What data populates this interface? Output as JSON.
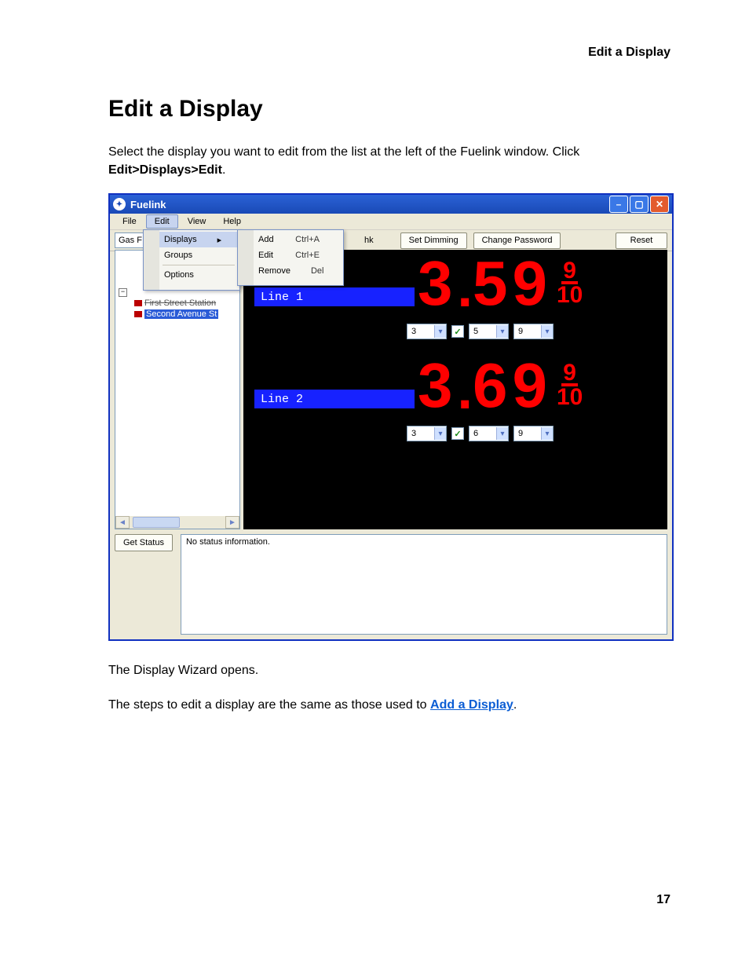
{
  "doc": {
    "running_head": "Edit a Display",
    "title": "Edit a Display",
    "para1": "Select the display you want to edit from the list at the left of the Fuelink window. Click ",
    "para1_bold": "Edit>Displays>Edit",
    "para1_tail": ".",
    "para2": "The Display Wizard opens.",
    "para3a": "The steps to edit a display are the same as those used to ",
    "para3_link": "Add a Display",
    "para3b": ".",
    "page_number": "17"
  },
  "window": {
    "title": "Fuelink",
    "menu": {
      "file": "File",
      "edit": "Edit",
      "view": "View",
      "help": "Help"
    },
    "edit_menu": {
      "displays": "Displays",
      "groups": "Groups",
      "options": "Options"
    },
    "displays_submenu": {
      "add": {
        "label": "Add",
        "shortcut": "Ctrl+A"
      },
      "edit": {
        "label": "Edit",
        "shortcut": "Ctrl+E"
      },
      "remove": {
        "label": "Remove",
        "shortcut": "Del"
      }
    },
    "toolbar": {
      "combo_text": "Gas F",
      "hk": "hk",
      "set_dimming": "Set Dimming",
      "change_password": "Change Password",
      "reset": "Reset"
    },
    "tree": {
      "first": "First Street Station",
      "second": "Second Avenue St"
    },
    "canvas": {
      "line1": {
        "label": "Line 1",
        "d1": "3",
        "d2": "5",
        "d3": "9",
        "frac_n": "9",
        "frac_d": "10",
        "sel1": "3",
        "sel2": "5",
        "sel3": "9"
      },
      "line2": {
        "label": "Line 2",
        "d1": "3",
        "d2": "6",
        "d3": "9",
        "frac_n": "9",
        "frac_d": "10",
        "sel1": "3",
        "sel2": "6",
        "sel3": "9"
      }
    },
    "status": {
      "get_status": "Get Status",
      "text": "No status information."
    }
  }
}
